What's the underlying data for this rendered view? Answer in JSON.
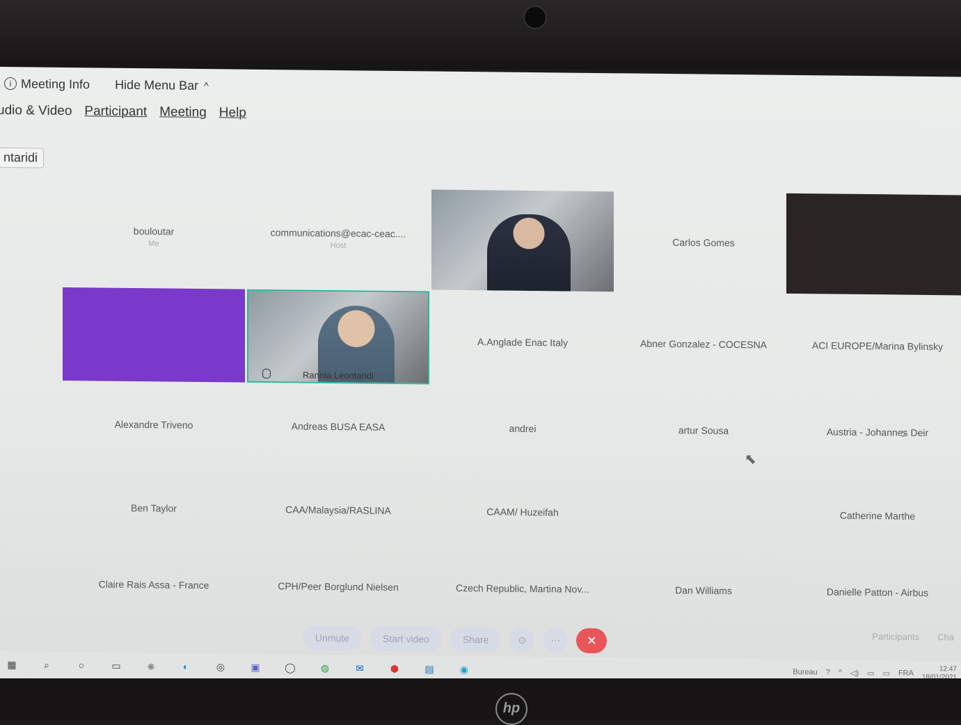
{
  "topbar": {
    "meeting_info": "Meeting Info",
    "hide_menu_bar": "Hide Menu Bar"
  },
  "menu": [
    "udio & Video",
    "Participant",
    "Meeting",
    "Help"
  ],
  "active_speaker_tag": "ntaridi",
  "tiles": [
    {
      "name": "bouloutar",
      "sub": "Me",
      "kind": "blank"
    },
    {
      "name": "communications@ecac-ceac....",
      "sub": "Host",
      "kind": "blank"
    },
    {
      "name": "",
      "kind": "video"
    },
    {
      "name": "Carlos Gomes",
      "kind": "blank"
    },
    {
      "name": "",
      "kind": "dark"
    },
    {
      "name": "",
      "kind": "purple"
    },
    {
      "name": "Rannia Leontaridi",
      "kind": "active"
    },
    {
      "name": "A.Anglade Enac Italy",
      "kind": "blank"
    },
    {
      "name": "Abner Gonzalez - COCESNA",
      "kind": "blank"
    },
    {
      "name": "ACI EUROPE/Marina Bylinsky",
      "kind": "blank"
    },
    {
      "name": "Alexandre Triveno",
      "kind": "blank"
    },
    {
      "name": "Andreas BUSA EASA",
      "kind": "blank"
    },
    {
      "name": "andrei",
      "kind": "blank"
    },
    {
      "name": "artur Sousa",
      "kind": "blank"
    },
    {
      "name": "Austria - Johannes Deir",
      "kind": "blank"
    },
    {
      "name": "Ben Taylor",
      "kind": "blank"
    },
    {
      "name": "CAA/Malaysia/RASLINA",
      "kind": "blank"
    },
    {
      "name": "CAAM/ Huzeifah",
      "kind": "blank"
    },
    {
      "name": "",
      "kind": "blank"
    },
    {
      "name": "Catherine Marthe",
      "kind": "blank"
    },
    {
      "name": "Claire Rais Assa - France",
      "kind": "blank"
    },
    {
      "name": "CPH/Peer Borglund Nielsen",
      "kind": "blank"
    },
    {
      "name": "Czech Republic, Martina Nov...",
      "kind": "blank"
    },
    {
      "name": "Dan Williams",
      "kind": "blank"
    },
    {
      "name": "Danielle Patton - Airbus",
      "kind": "blank"
    }
  ],
  "controls": {
    "unmute": "Unmute",
    "start_video": "Start video",
    "share": "Share"
  },
  "side": {
    "participants": "Participants",
    "chat": "Cha"
  },
  "tray": {
    "desktop": "Bureau",
    "lang": "FRA",
    "time": "12:47",
    "date": "18/01/2021"
  }
}
